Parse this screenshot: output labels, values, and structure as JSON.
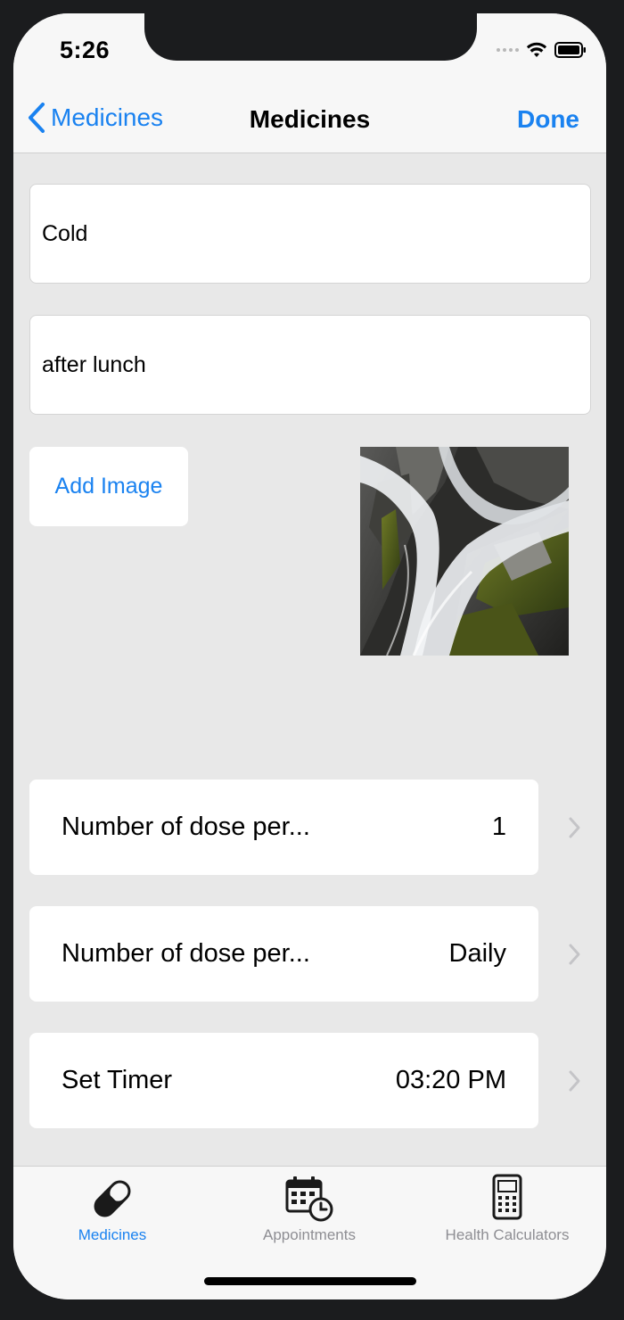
{
  "status_bar": {
    "time": "5:26"
  },
  "nav": {
    "back_label": "Medicines",
    "title": "Medicines",
    "done_label": "Done"
  },
  "form": {
    "name_value": "Cold",
    "note_value": "after lunch",
    "add_image_label": "Add Image"
  },
  "rows": [
    {
      "label": "Number of dose per...",
      "value": "1"
    },
    {
      "label": "Number of dose per...",
      "value": "Daily"
    },
    {
      "label": "Set Timer",
      "value": "03:20 PM"
    }
  ],
  "tabs": [
    {
      "label": "Medicines",
      "icon": "pill-icon",
      "selected": true
    },
    {
      "label": "Appointments",
      "icon": "calendar-clock-icon",
      "selected": false
    },
    {
      "label": "Health Calculators",
      "icon": "calculator-icon",
      "selected": false
    }
  ],
  "colors": {
    "accent": "#1a82f0",
    "background": "#e8e8e8",
    "bar": "#f7f7f7"
  }
}
